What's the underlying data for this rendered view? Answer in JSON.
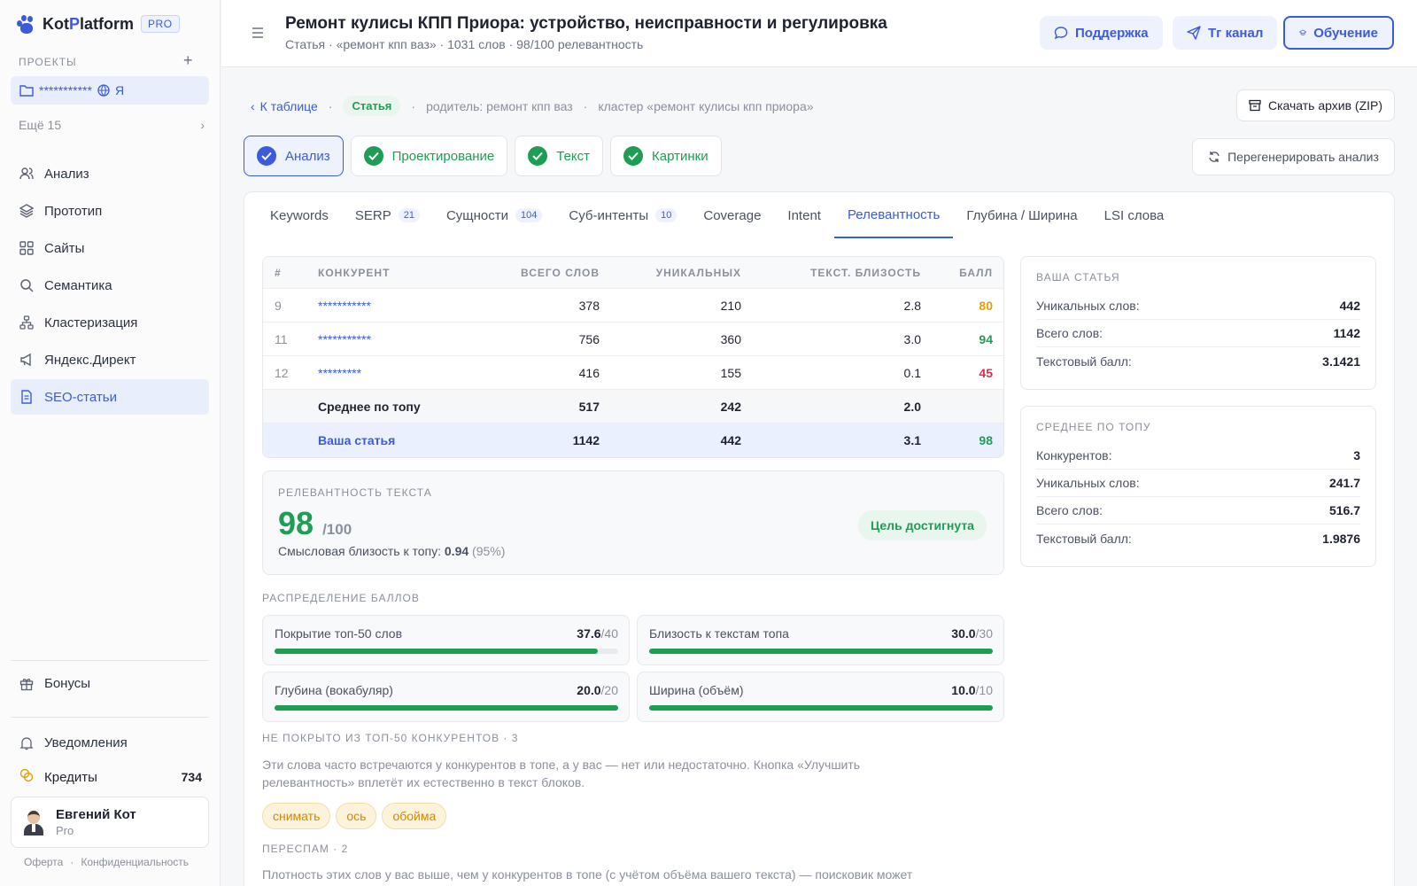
{
  "app": {
    "name_prefix": "Kot",
    "name_p": "P",
    "name_suffix": "latform",
    "plan_badge": "PRO"
  },
  "sidebar": {
    "projects_label": "ПРОЕКТЫ",
    "project": {
      "name": "***********",
      "lang": "Я"
    },
    "more": "Ещё 15",
    "items": [
      {
        "label": "Анализ",
        "icon": "users-icon"
      },
      {
        "label": "Прототип",
        "icon": "layers-icon"
      },
      {
        "label": "Сайты",
        "icon": "grid-icon"
      },
      {
        "label": "Семантика",
        "icon": "search-icon"
      },
      {
        "label": "Кластеризация",
        "icon": "cluster-icon"
      },
      {
        "label": "Яндекс.Директ",
        "icon": "megaphone-icon"
      },
      {
        "label": "SEO-статьи",
        "icon": "document-icon"
      }
    ],
    "bonuses": "Бонусы",
    "notifications": "Уведомления",
    "credits_label": "Кредиты",
    "credits_value": "734",
    "user": {
      "name": "Евгений Кот",
      "plan": "Pro"
    },
    "legal": [
      "Оферта",
      "Конфиденциальность"
    ]
  },
  "header": {
    "title": "Ремонт кулисы КПП Приора: устройство, неисправности и регулировка",
    "subtitle": "Статья · «ремонт кпп ваз» · 1031 слов · 98/100 релевантность",
    "buttons": {
      "support": "Поддержка",
      "tg": "Тг канал",
      "learn": "Обучение"
    }
  },
  "crumbs": {
    "back": "К таблице",
    "type": "Статья",
    "parent": "родитель: ремонт кпп ваз",
    "cluster": "кластер «ремонт кулисы кпп приора»",
    "zip": "Скачать архив (ZIP)"
  },
  "steps": [
    "Анализ",
    "Проектирование",
    "Текст",
    "Картинки"
  ],
  "regen": "Перегенерировать анализ",
  "tabs": [
    {
      "label": "Keywords",
      "count": ""
    },
    {
      "label": "SERP",
      "count": "21"
    },
    {
      "label": "Сущности",
      "count": "104"
    },
    {
      "label": "Суб-интенты",
      "count": "10"
    },
    {
      "label": "Coverage",
      "count": ""
    },
    {
      "label": "Intent",
      "count": ""
    },
    {
      "label": "Релевантность",
      "count": ""
    },
    {
      "label": "Глубина / Ширина",
      "count": ""
    },
    {
      "label": "LSI слова",
      "count": ""
    }
  ],
  "table": {
    "headers": [
      "#",
      "КОНКУРЕНТ",
      "ВСЕГО СЛОВ",
      "УНИКАЛЬНЫХ",
      "ТЕКСТ. БЛИЗОСТЬ",
      "БАЛЛ"
    ],
    "rows": [
      {
        "n": "9",
        "name": "***********",
        "total": "378",
        "unique": "210",
        "sim": "2.8",
        "score": "80",
        "level": "mid"
      },
      {
        "n": "11",
        "name": "***********",
        "total": "756",
        "unique": "360",
        "sim": "3.0",
        "score": "94",
        "level": "hi"
      },
      {
        "n": "12",
        "name": "*********",
        "total": "416",
        "unique": "155",
        "sim": "0.1",
        "score": "45",
        "level": "lo"
      }
    ],
    "avg": {
      "name": "Среднее по топу",
      "total": "517",
      "unique": "242",
      "sim": "2.0"
    },
    "mine": {
      "name": "Ваша статья",
      "total": "1142",
      "unique": "442",
      "sim": "3.1",
      "score": "98"
    }
  },
  "relevance": {
    "label": "РЕЛЕВАНТНОСТЬ ТЕКСТА",
    "score": "98",
    "max": "/100",
    "semantic_label": "Смысловая близость к топу:",
    "semantic_value": "0.94",
    "semantic_pct": "(95%)",
    "goal": "Цель достигнута"
  },
  "distribution": {
    "label": "РАСПРЕДЕЛЕНИЕ БАЛЛОВ",
    "items": [
      {
        "name": "Покрытие топ-50 слов",
        "value": "37.6",
        "max": "/40",
        "fraction": 0.94
      },
      {
        "name": "Близость к текстам топа",
        "value": "30.0",
        "max": "/30",
        "fraction": 1.0
      },
      {
        "name": "Глубина (вокабуляр)",
        "value": "20.0",
        "max": "/20",
        "fraction": 1.0
      },
      {
        "name": "Ширина (объём)",
        "value": "10.0",
        "max": "/10",
        "fraction": 1.0
      }
    ]
  },
  "uncovered": {
    "label": "НЕ ПОКРЫТО ИЗ ТОП-50 КОНКУРЕНТОВ · 3",
    "text": "Эти слова часто встречаются у конкурентов в топе, а у вас — нет или недостаточно. Кнопка «Улучшить релевантность» вплетёт их естественно в текст блоков.",
    "words": [
      "снимать",
      "ось",
      "обойма"
    ]
  },
  "spam": {
    "label": "ПЕРЕСПАМ · 2",
    "text": "Плотность этих слов у вас выше, чем у конкурентов в топе (с учётом объёма вашего текста) — поисковик может"
  },
  "your_article": {
    "label": "ВАША СТАТЬЯ",
    "rows": [
      {
        "k": "Уникальных слов:",
        "v": "442"
      },
      {
        "k": "Всего слов:",
        "v": "1142"
      },
      {
        "k": "Текстовый балл:",
        "v": "3.1421"
      }
    ]
  },
  "top_avg": {
    "label": "СРЕДНЕЕ ПО ТОПУ",
    "rows": [
      {
        "k": "Конкурентов:",
        "v": "3"
      },
      {
        "k": "Уникальных слов:",
        "v": "241.7"
      },
      {
        "k": "Всего слов:",
        "v": "516.7"
      },
      {
        "k": "Текстовый балл:",
        "v": "1.9876"
      }
    ]
  }
}
